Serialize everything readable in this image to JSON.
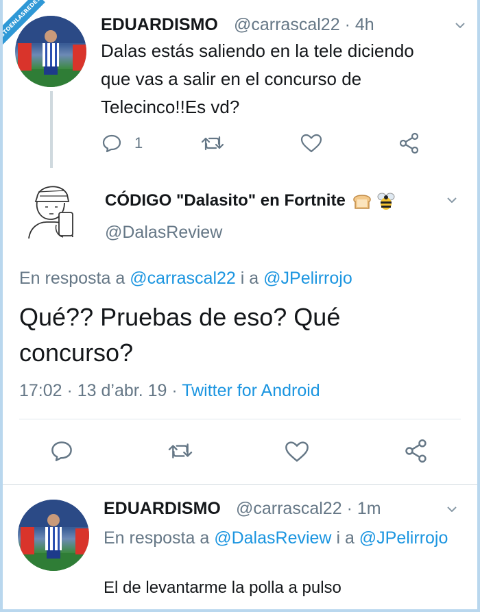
{
  "watermark": "VISTOENLASREDES.com",
  "tweet1": {
    "name": "EDUARDISMO",
    "handle": "@carrascal22",
    "time": "· 4h",
    "text_line1": "Dalas estás saliendo en la tele diciendo",
    "text_line2": "que vas a salir en el concurso de",
    "text_line3": "Telecinco!!Es vd?",
    "reply_count": "1"
  },
  "tweet2": {
    "name": "CÓDIGO \"Dalasito\" en Fortnite",
    "name_emojis": [
      "bread-icon",
      "bee-icon"
    ],
    "handle": "@DalasReview",
    "reply_prefix": "En resposta a",
    "reply_user1": "@carrascal22",
    "reply_and": "i a",
    "reply_user2": "@JPelirrojo",
    "text_line1": "Qué?? Pruebas de eso? Qué",
    "text_line2": "concurso?",
    "timestamp": "17:02 · 13 d’abr. 19 ·",
    "source": "Twitter for Android"
  },
  "tweet3": {
    "name": "EDUARDISMO",
    "handle": "@carrascal22",
    "time": "· 1m",
    "reply_prefix": "En resposta a",
    "reply_user1": "@DalasReview",
    "reply_and": "i a",
    "reply_user2": "@JPelirrojo",
    "text": "El de levantarme la polla a pulso"
  },
  "colors": {
    "accent": "#1b95e0",
    "muted": "#657786",
    "text": "#14171a",
    "divider": "#e1e8ed",
    "frame": "#b9d7ee"
  }
}
